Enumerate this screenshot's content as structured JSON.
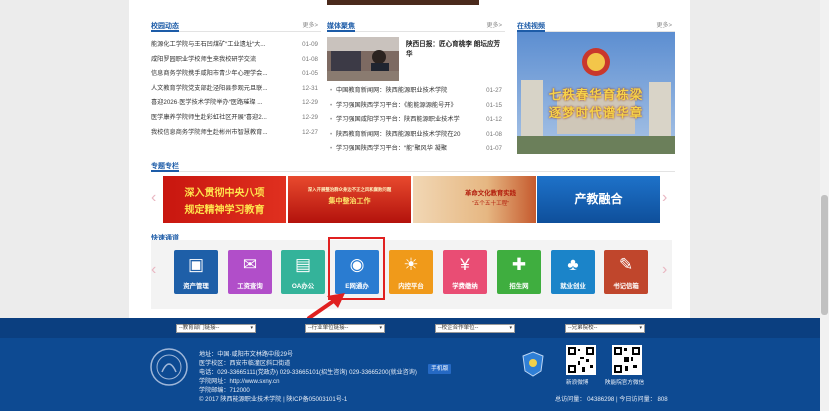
{
  "campus_news": {
    "title": "校园动态",
    "more": "更多>",
    "items": [
      {
        "title": "能源化工学院与王石凹煤矿“工业遗址“大...",
        "date": "01-09"
      },
      {
        "title": "咸阳罗园职业学校师生来我校研学交流",
        "date": "01-08"
      },
      {
        "title": "信息商务学院携手咸阳市青少年心理学会...",
        "date": "01-05"
      },
      {
        "title": "人文教育学院党支部赴泾阳县参观元旦联...",
        "date": "12-31"
      },
      {
        "title": "喜迎2026·医学技术学院举办“医路璀璨 ...",
        "date": "12-29"
      },
      {
        "title": "医学康养学院师生赴彩虹社区开展“喜迎2...",
        "date": "12-29"
      },
      {
        "title": "我校信息商务学院师生赴彬州市智慧教育...",
        "date": "12-27"
      }
    ]
  },
  "media_focus": {
    "title": "媒体聚焦",
    "more": "更多>",
    "featured_caption": "陕西日报：匠心育桃李 朗坛应芳华",
    "items": [
      {
        "title": "中国教育新闻网：陕西能源职业技术学院",
        "date": "01-27"
      },
      {
        "title": "学习强国陕西学习平台：《能能源源能号开》",
        "date": "01-15"
      },
      {
        "title": "学习强国咸阳学习平台：陕西能源职业技术学",
        "date": "01-12"
      },
      {
        "title": "陕西教育新闻网：陕西能源职业技术学院在20",
        "date": "01-08"
      },
      {
        "title": "学习强国陕西学习平台：“能”聚风华 凝聚",
        "date": "01-07"
      }
    ]
  },
  "online_video": {
    "title": "在线视频",
    "more": "更多>",
    "overlay_line1": "七秩春华育栋梁",
    "overlay_line2": "逐梦时代谱华章"
  },
  "special": {
    "title": "专题专栏",
    "banners": [
      {
        "line1": "深入贯彻中央八项",
        "line2": "规定精神学习教育"
      },
      {
        "line1": "深入开展整治群众身边不正之风和腐败问题",
        "line2": "集中整治工作"
      },
      {
        "line1": "革命文化教育实践",
        "line2": "“五个五十工程”"
      },
      {
        "line1": "产教融合",
        "line2": ""
      }
    ]
  },
  "quick_access": {
    "title": "快速通道",
    "items": [
      {
        "label": "资产管理",
        "icon": "box-icon",
        "color": "#1e5fa8"
      },
      {
        "label": "工资查询",
        "icon": "ticket-icon",
        "color": "#b14ec9"
      },
      {
        "label": "OA办公",
        "icon": "document-icon",
        "color": "#34b39a"
      },
      {
        "label": "E网通办",
        "icon": "counter-icon",
        "color": "#2a7cd1"
      },
      {
        "label": "内控平台",
        "icon": "sunrise-icon",
        "color": "#f09a1a"
      },
      {
        "label": "学费缴纳",
        "icon": "yen-icon",
        "color": "#e94d74"
      },
      {
        "label": "招生网",
        "icon": "user-add-icon",
        "color": "#3fae3f"
      },
      {
        "label": "就业创业",
        "icon": "handshake-icon",
        "color": "#1b84c9"
      },
      {
        "label": "书记信箱",
        "icon": "mail-icon",
        "color": "#c0462c"
      }
    ]
  },
  "footer": {
    "selects": [
      "--教育部门链接--",
      "--行业单位链接--",
      "--校企合作单位--",
      "--兄弟院校--"
    ],
    "address": "地址：中国·咸阳市文林路中段29号",
    "campus": "医学校区：西安市临潼区斜口街道",
    "phone": "电话：029-33665111(党政办) 029-33665101(招生咨询) 029-33665200(就业咨询)",
    "mobile_label": "手机版",
    "url": "学院网址：http://www.sxny.cn",
    "postcode": "学院邮编：712000",
    "copyright": "© 2017 陕西能源职业技术学院 | 陕ICP备05003101号-1",
    "qr1_label": "新浪微博",
    "qr2_label": "陕能院官方微信",
    "visits": "总访问量：  04386298  |  今日访问量：  808"
  },
  "colors": {
    "accent": "#1d5ca8",
    "footer": "#0d4a92",
    "highlight": "#e02020"
  }
}
